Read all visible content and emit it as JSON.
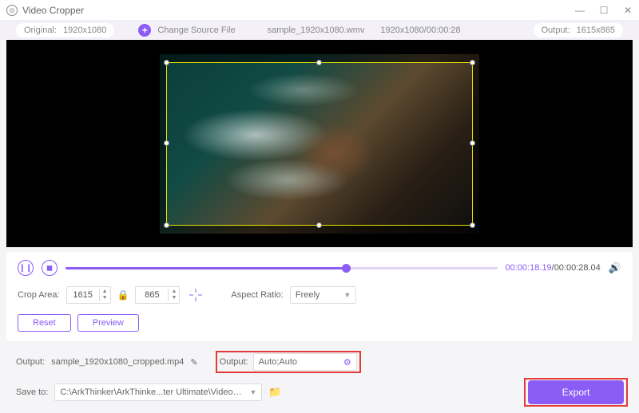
{
  "titlebar": {
    "title": "Video Cropper"
  },
  "infobar": {
    "original_label": "Original:",
    "original_value": "1920x1080",
    "change_source": "Change Source File",
    "filename": "sample_1920x1080.wmv",
    "res_time": "1920x1080/00:00:28",
    "output_label": "Output:",
    "output_value": "1615x865"
  },
  "playback": {
    "current": "00:00:18.19",
    "separator": "/",
    "total": "00:00:28.04"
  },
  "crop": {
    "label": "Crop Area:",
    "w": "1615",
    "h": "865",
    "aspect_label": "Aspect Ratio:",
    "aspect_value": "Freely"
  },
  "buttons": {
    "reset": "Reset",
    "preview": "Preview",
    "export": "Export"
  },
  "output": {
    "label": "Output:",
    "filename": "sample_1920x1080_cropped.mp4",
    "settings_label": "Output:",
    "settings_value": "Auto;Auto"
  },
  "save": {
    "label": "Save to:",
    "path": "C:\\ArkThinker\\ArkThinke...ter Ultimate\\Video Crop"
  }
}
